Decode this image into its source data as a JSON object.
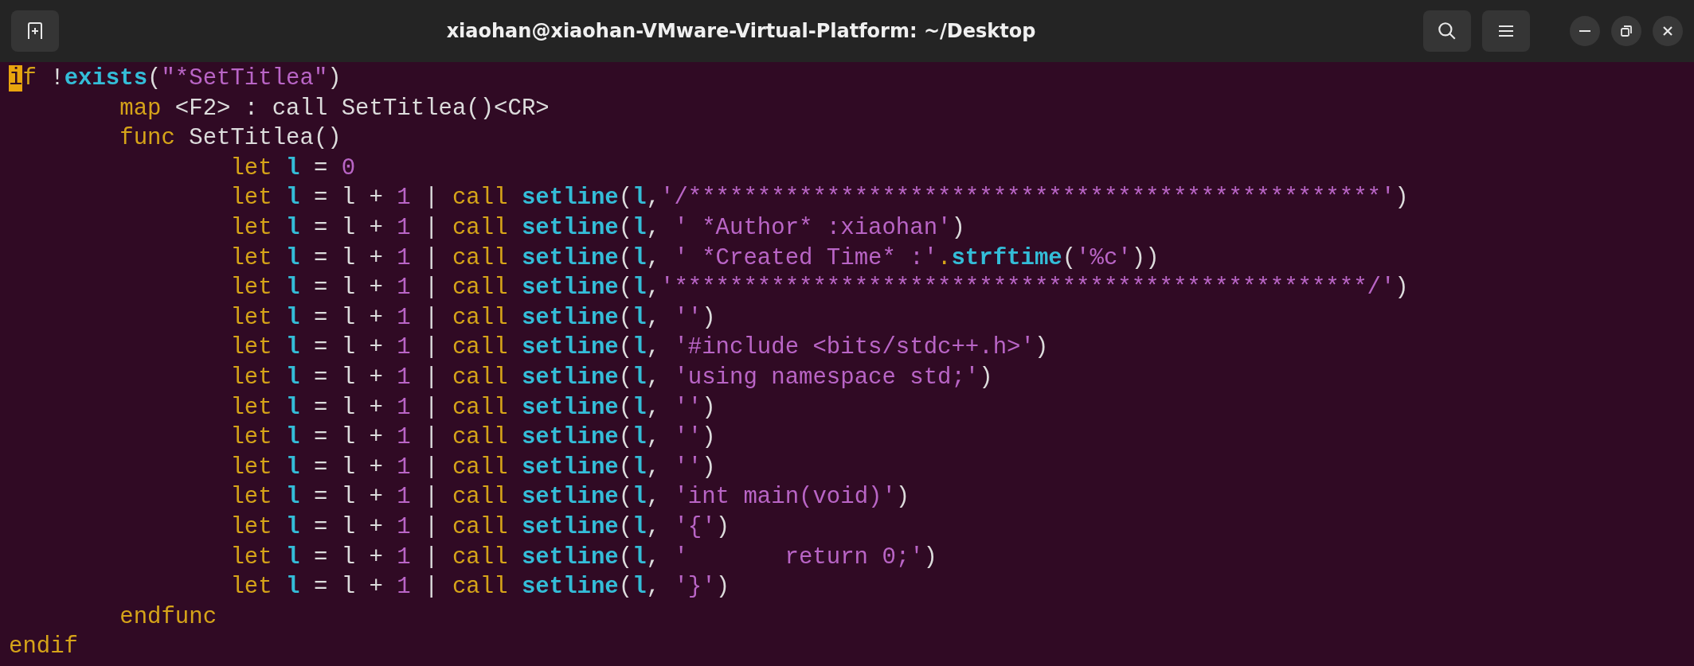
{
  "window": {
    "title": "xiaohan@xiaohan-VMware-Virtual-Platform: ~/Desktop"
  },
  "editor": {
    "lines": [
      {
        "tokens": [
          {
            "kind": "cursor",
            "text": "i"
          },
          {
            "kind": "kw",
            "text": "f"
          },
          {
            "kind": "txt",
            "text": " !"
          },
          {
            "kind": "fn",
            "text": "exists"
          },
          {
            "kind": "txt",
            "text": "("
          },
          {
            "kind": "str",
            "text": "\"*SetTitlea\""
          },
          {
            "kind": "txt",
            "text": ")"
          }
        ]
      },
      {
        "tokens": [
          {
            "kind": "kw",
            "text": "\tmap"
          },
          {
            "kind": "txt",
            "text": " <F2> : call SetTitlea()<CR>"
          }
        ]
      },
      {
        "tokens": [
          {
            "kind": "kw",
            "text": "\tfunc"
          },
          {
            "kind": "txt",
            "text": " SetTitlea()"
          }
        ]
      },
      {
        "tokens": [
          {
            "kind": "kw",
            "text": "\t\tlet "
          },
          {
            "kind": "var",
            "text": "l"
          },
          {
            "kind": "txt",
            "text": " = "
          },
          {
            "kind": "num",
            "text": "0"
          }
        ]
      },
      {
        "tokens": [
          {
            "kind": "kw",
            "text": "\t\tlet "
          },
          {
            "kind": "var",
            "text": "l"
          },
          {
            "kind": "txt",
            "text": " = l + "
          },
          {
            "kind": "num",
            "text": "1"
          },
          {
            "kind": "txt",
            "text": " | "
          },
          {
            "kind": "kw",
            "text": "call "
          },
          {
            "kind": "fn",
            "text": "setline"
          },
          {
            "kind": "txt",
            "text": "("
          },
          {
            "kind": "var",
            "text": "l"
          },
          {
            "kind": "txt",
            "text": ","
          },
          {
            "kind": "str",
            "text": "'/**************************************************'"
          },
          {
            "kind": "txt",
            "text": ")"
          }
        ]
      },
      {
        "tokens": [
          {
            "kind": "kw",
            "text": "\t\tlet "
          },
          {
            "kind": "var",
            "text": "l"
          },
          {
            "kind": "txt",
            "text": " = l + "
          },
          {
            "kind": "num",
            "text": "1"
          },
          {
            "kind": "txt",
            "text": " | "
          },
          {
            "kind": "kw",
            "text": "call "
          },
          {
            "kind": "fn",
            "text": "setline"
          },
          {
            "kind": "txt",
            "text": "("
          },
          {
            "kind": "var",
            "text": "l"
          },
          {
            "kind": "txt",
            "text": ","
          },
          {
            "kind": "str",
            "text": " ' *Author* :xiaohan'"
          },
          {
            "kind": "txt",
            "text": ")"
          }
        ]
      },
      {
        "tokens": [
          {
            "kind": "kw",
            "text": "\t\tlet "
          },
          {
            "kind": "var",
            "text": "l"
          },
          {
            "kind": "txt",
            "text": " = l + "
          },
          {
            "kind": "num",
            "text": "1"
          },
          {
            "kind": "txt",
            "text": " | "
          },
          {
            "kind": "kw",
            "text": "call "
          },
          {
            "kind": "fn",
            "text": "setline"
          },
          {
            "kind": "txt",
            "text": "("
          },
          {
            "kind": "var",
            "text": "l"
          },
          {
            "kind": "txt",
            "text": ","
          },
          {
            "kind": "str",
            "text": " ' *Created Time* :'"
          },
          {
            "kind": "kw",
            "text": "."
          },
          {
            "kind": "fn",
            "text": "strftime"
          },
          {
            "kind": "txt",
            "text": "("
          },
          {
            "kind": "str",
            "text": "'%c'"
          },
          {
            "kind": "txt",
            "text": "))"
          }
        ]
      },
      {
        "tokens": [
          {
            "kind": "kw",
            "text": "\t\tlet "
          },
          {
            "kind": "var",
            "text": "l"
          },
          {
            "kind": "txt",
            "text": " = l + "
          },
          {
            "kind": "num",
            "text": "1"
          },
          {
            "kind": "txt",
            "text": " | "
          },
          {
            "kind": "kw",
            "text": "call "
          },
          {
            "kind": "fn",
            "text": "setline"
          },
          {
            "kind": "txt",
            "text": "("
          },
          {
            "kind": "var",
            "text": "l"
          },
          {
            "kind": "txt",
            "text": ","
          },
          {
            "kind": "str",
            "text": "'**************************************************/'"
          },
          {
            "kind": "txt",
            "text": ")"
          }
        ]
      },
      {
        "tokens": [
          {
            "kind": "kw",
            "text": "\t\tlet "
          },
          {
            "kind": "var",
            "text": "l"
          },
          {
            "kind": "txt",
            "text": " = l + "
          },
          {
            "kind": "num",
            "text": "1"
          },
          {
            "kind": "txt",
            "text": " | "
          },
          {
            "kind": "kw",
            "text": "call "
          },
          {
            "kind": "fn",
            "text": "setline"
          },
          {
            "kind": "txt",
            "text": "("
          },
          {
            "kind": "var",
            "text": "l"
          },
          {
            "kind": "txt",
            "text": ","
          },
          {
            "kind": "str",
            "text": " ''"
          },
          {
            "kind": "txt",
            "text": ")"
          }
        ]
      },
      {
        "tokens": [
          {
            "kind": "kw",
            "text": "\t\tlet "
          },
          {
            "kind": "var",
            "text": "l"
          },
          {
            "kind": "txt",
            "text": " = l + "
          },
          {
            "kind": "num",
            "text": "1"
          },
          {
            "kind": "txt",
            "text": " | "
          },
          {
            "kind": "kw",
            "text": "call "
          },
          {
            "kind": "fn",
            "text": "setline"
          },
          {
            "kind": "txt",
            "text": "("
          },
          {
            "kind": "var",
            "text": "l"
          },
          {
            "kind": "txt",
            "text": ","
          },
          {
            "kind": "str",
            "text": " '#include <bits/stdc++.h>'"
          },
          {
            "kind": "txt",
            "text": ")"
          }
        ]
      },
      {
        "tokens": [
          {
            "kind": "kw",
            "text": "\t\tlet "
          },
          {
            "kind": "var",
            "text": "l"
          },
          {
            "kind": "txt",
            "text": " = l + "
          },
          {
            "kind": "num",
            "text": "1"
          },
          {
            "kind": "txt",
            "text": " | "
          },
          {
            "kind": "kw",
            "text": "call "
          },
          {
            "kind": "fn",
            "text": "setline"
          },
          {
            "kind": "txt",
            "text": "("
          },
          {
            "kind": "var",
            "text": "l"
          },
          {
            "kind": "txt",
            "text": ","
          },
          {
            "kind": "str",
            "text": " 'using namespace std;'"
          },
          {
            "kind": "txt",
            "text": ")"
          }
        ]
      },
      {
        "tokens": [
          {
            "kind": "kw",
            "text": "\t\tlet "
          },
          {
            "kind": "var",
            "text": "l"
          },
          {
            "kind": "txt",
            "text": " = l + "
          },
          {
            "kind": "num",
            "text": "1"
          },
          {
            "kind": "txt",
            "text": " | "
          },
          {
            "kind": "kw",
            "text": "call "
          },
          {
            "kind": "fn",
            "text": "setline"
          },
          {
            "kind": "txt",
            "text": "("
          },
          {
            "kind": "var",
            "text": "l"
          },
          {
            "kind": "txt",
            "text": ","
          },
          {
            "kind": "str",
            "text": " ''"
          },
          {
            "kind": "txt",
            "text": ")"
          }
        ]
      },
      {
        "tokens": [
          {
            "kind": "kw",
            "text": "\t\tlet "
          },
          {
            "kind": "var",
            "text": "l"
          },
          {
            "kind": "txt",
            "text": " = l + "
          },
          {
            "kind": "num",
            "text": "1"
          },
          {
            "kind": "txt",
            "text": " | "
          },
          {
            "kind": "kw",
            "text": "call "
          },
          {
            "kind": "fn",
            "text": "setline"
          },
          {
            "kind": "txt",
            "text": "("
          },
          {
            "kind": "var",
            "text": "l"
          },
          {
            "kind": "txt",
            "text": ","
          },
          {
            "kind": "str",
            "text": " ''"
          },
          {
            "kind": "txt",
            "text": ")"
          }
        ]
      },
      {
        "tokens": [
          {
            "kind": "kw",
            "text": "\t\tlet "
          },
          {
            "kind": "var",
            "text": "l"
          },
          {
            "kind": "txt",
            "text": " = l + "
          },
          {
            "kind": "num",
            "text": "1"
          },
          {
            "kind": "txt",
            "text": " | "
          },
          {
            "kind": "kw",
            "text": "call "
          },
          {
            "kind": "fn",
            "text": "setline"
          },
          {
            "kind": "txt",
            "text": "("
          },
          {
            "kind": "var",
            "text": "l"
          },
          {
            "kind": "txt",
            "text": ","
          },
          {
            "kind": "str",
            "text": " ''"
          },
          {
            "kind": "txt",
            "text": ")"
          }
        ]
      },
      {
        "tokens": [
          {
            "kind": "kw",
            "text": "\t\tlet "
          },
          {
            "kind": "var",
            "text": "l"
          },
          {
            "kind": "txt",
            "text": " = l + "
          },
          {
            "kind": "num",
            "text": "1"
          },
          {
            "kind": "txt",
            "text": " | "
          },
          {
            "kind": "kw",
            "text": "call "
          },
          {
            "kind": "fn",
            "text": "setline"
          },
          {
            "kind": "txt",
            "text": "("
          },
          {
            "kind": "var",
            "text": "l"
          },
          {
            "kind": "txt",
            "text": ","
          },
          {
            "kind": "str",
            "text": " 'int main(void)'"
          },
          {
            "kind": "txt",
            "text": ")"
          }
        ]
      },
      {
        "tokens": [
          {
            "kind": "kw",
            "text": "\t\tlet "
          },
          {
            "kind": "var",
            "text": "l"
          },
          {
            "kind": "txt",
            "text": " = l + "
          },
          {
            "kind": "num",
            "text": "1"
          },
          {
            "kind": "txt",
            "text": " | "
          },
          {
            "kind": "kw",
            "text": "call "
          },
          {
            "kind": "fn",
            "text": "setline"
          },
          {
            "kind": "txt",
            "text": "("
          },
          {
            "kind": "var",
            "text": "l"
          },
          {
            "kind": "txt",
            "text": ","
          },
          {
            "kind": "str",
            "text": " '{'"
          },
          {
            "kind": "txt",
            "text": ")"
          }
        ]
      },
      {
        "tokens": [
          {
            "kind": "kw",
            "text": "\t\tlet "
          },
          {
            "kind": "var",
            "text": "l"
          },
          {
            "kind": "txt",
            "text": " = l + "
          },
          {
            "kind": "num",
            "text": "1"
          },
          {
            "kind": "txt",
            "text": " | "
          },
          {
            "kind": "kw",
            "text": "call "
          },
          {
            "kind": "fn",
            "text": "setline"
          },
          {
            "kind": "txt",
            "text": "("
          },
          {
            "kind": "var",
            "text": "l"
          },
          {
            "kind": "txt",
            "text": ","
          },
          {
            "kind": "str",
            "text": " '\treturn 0;'"
          },
          {
            "kind": "txt",
            "text": ")"
          }
        ]
      },
      {
        "tokens": [
          {
            "kind": "kw",
            "text": "\t\tlet "
          },
          {
            "kind": "var",
            "text": "l"
          },
          {
            "kind": "txt",
            "text": " = l + "
          },
          {
            "kind": "num",
            "text": "1"
          },
          {
            "kind": "txt",
            "text": " | "
          },
          {
            "kind": "kw",
            "text": "call "
          },
          {
            "kind": "fn",
            "text": "setline"
          },
          {
            "kind": "txt",
            "text": "("
          },
          {
            "kind": "var",
            "text": "l"
          },
          {
            "kind": "txt",
            "text": ","
          },
          {
            "kind": "str",
            "text": " '}'"
          },
          {
            "kind": "txt",
            "text": ")"
          }
        ]
      },
      {
        "tokens": [
          {
            "kind": "kw",
            "text": "\tendfunc"
          }
        ]
      },
      {
        "tokens": [
          {
            "kind": "kw",
            "text": "endif"
          }
        ]
      }
    ]
  }
}
